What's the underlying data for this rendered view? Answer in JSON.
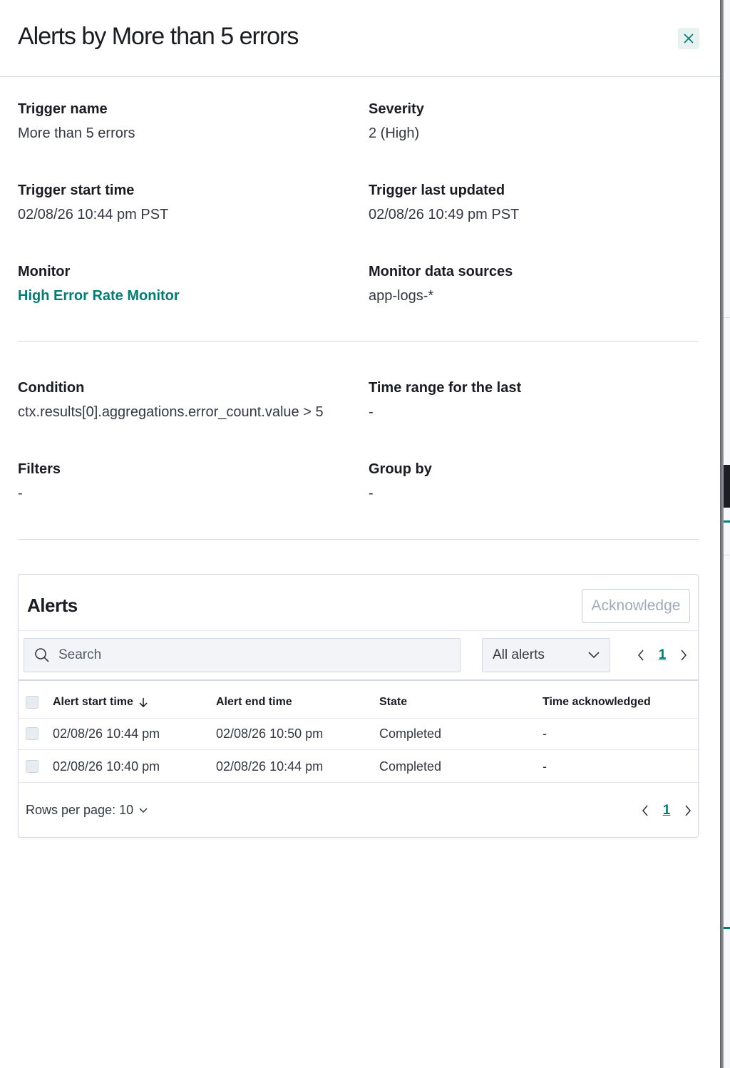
{
  "flyout": {
    "title": "Alerts by More than 5 errors"
  },
  "details": {
    "trigger_name": {
      "label": "Trigger name",
      "value": "More than 5 errors"
    },
    "severity": {
      "label": "Severity",
      "value": "2 (High)"
    },
    "trigger_start_time": {
      "label": "Trigger start time",
      "value": "02/08/26 10:44 pm PST"
    },
    "trigger_last_updated": {
      "label": "Trigger last updated",
      "value": "02/08/26 10:49 pm PST"
    },
    "monitor": {
      "label": "Monitor",
      "value": "High Error Rate Monitor"
    },
    "monitor_data_sources": {
      "label": "Monitor data sources",
      "value": "app-logs-*"
    }
  },
  "conditions": {
    "condition": {
      "label": "Condition",
      "value": "ctx.results[0].aggregations.error_count.value > 5"
    },
    "time_range": {
      "label": "Time range for the last",
      "value": "-"
    },
    "filters": {
      "label": "Filters",
      "value": "-"
    },
    "group_by": {
      "label": "Group by",
      "value": "-"
    }
  },
  "alerts_panel": {
    "title": "Alerts",
    "acknowledge_label": "Acknowledge",
    "search_placeholder": "Search",
    "filter_selected": "All alerts",
    "current_page": "1",
    "columns": [
      "Alert start time",
      "Alert end time",
      "State",
      "Time acknowledged"
    ],
    "rows": [
      {
        "start": "02/08/26 10:44 pm",
        "end": "02/08/26 10:50 pm",
        "state": "Completed",
        "acknowledged": "-"
      },
      {
        "start": "02/08/26 10:40 pm",
        "end": "02/08/26 10:44 pm",
        "state": "Completed",
        "acknowledged": "-"
      }
    ],
    "rows_per_page": "Rows per page: 10"
  },
  "colors": {
    "link": "#017d73",
    "text": "#1a1c21",
    "border": "#d3dae6"
  },
  "icons": [
    "close-icon",
    "search-icon",
    "chevron-down-icon",
    "chevron-left-icon",
    "chevron-right-icon",
    "arrow-down-icon"
  ]
}
